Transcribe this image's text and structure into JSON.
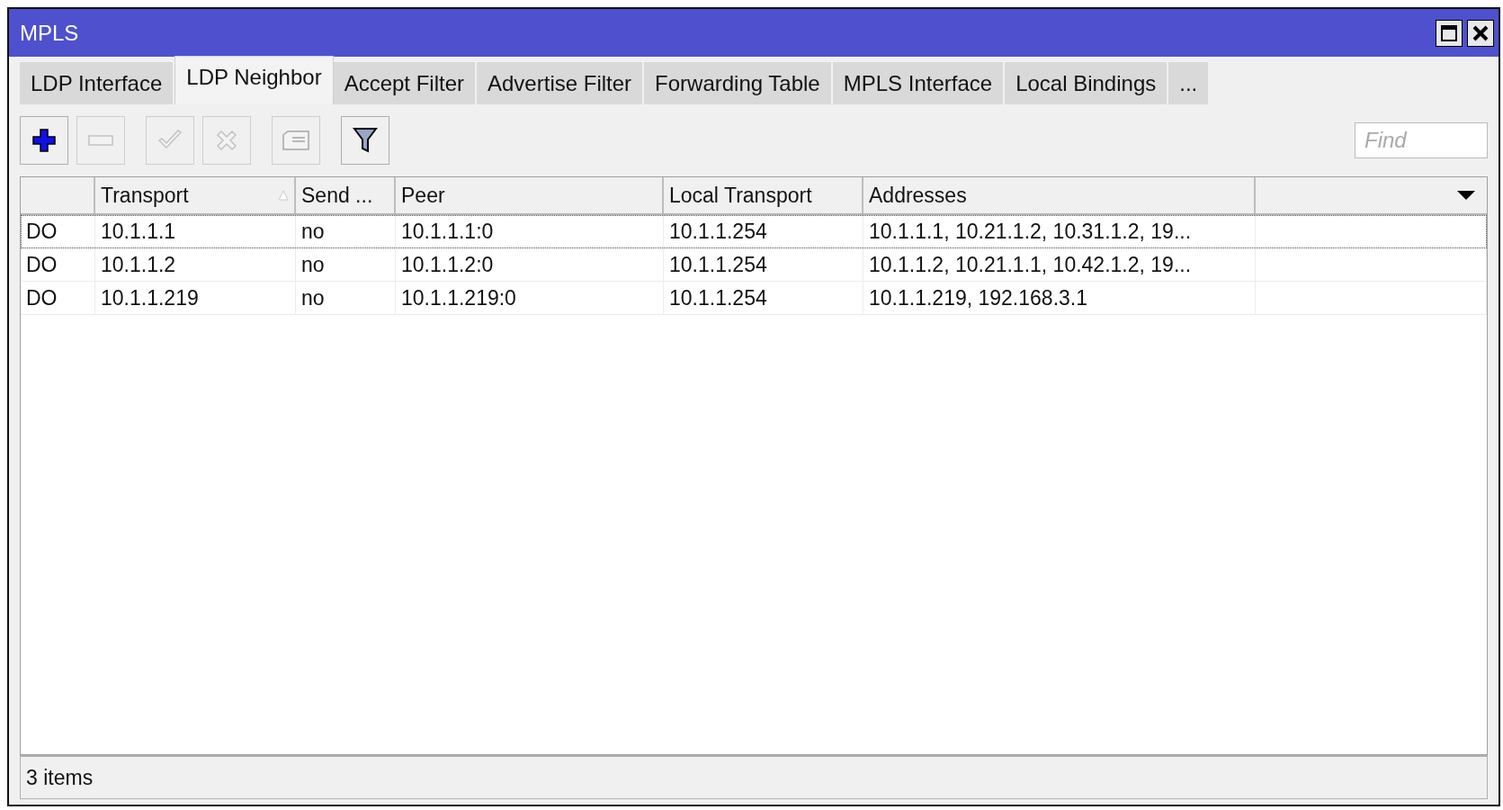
{
  "window": {
    "title": "MPLS"
  },
  "tabs": [
    {
      "label": "LDP Interface",
      "selected": false
    },
    {
      "label": "LDP Neighbor",
      "selected": true
    },
    {
      "label": "Accept Filter",
      "selected": false
    },
    {
      "label": "Advertise Filter",
      "selected": false
    },
    {
      "label": "Forwarding Table",
      "selected": false
    },
    {
      "label": "MPLS Interface",
      "selected": false
    },
    {
      "label": "Local Bindings",
      "selected": false
    },
    {
      "label": "...",
      "selected": false
    }
  ],
  "toolbar": [
    {
      "kind": "add",
      "disabled": false
    },
    {
      "kind": "remove",
      "disabled": true
    },
    {
      "kind": "enable",
      "disabled": true
    },
    {
      "kind": "disable",
      "disabled": true
    },
    {
      "kind": "comment",
      "disabled": true
    },
    {
      "kind": "filter",
      "disabled": false
    }
  ],
  "search": {
    "placeholder": "Find"
  },
  "table": {
    "columns": [
      {
        "sorted": false
      },
      {
        "label": "Transport",
        "sorted": true
      },
      {
        "label": "Send ...",
        "sorted": false
      },
      {
        "label": "Peer",
        "sorted": false
      },
      {
        "label": "Local Transport",
        "sorted": false
      },
      {
        "label": "Addresses",
        "sorted": false
      }
    ],
    "rows": [
      {
        "selected": true,
        "cells": [
          "DO",
          "10.1.1.1",
          "no",
          "10.1.1.1:0",
          "10.1.1.254",
          "10.1.1.1, 10.21.1.2, 10.31.1.2, 19..."
        ]
      },
      {
        "selected": false,
        "cells": [
          "DO",
          "10.1.1.2",
          "no",
          "10.1.1.2:0",
          "10.1.1.254",
          "10.1.1.2, 10.21.1.1, 10.42.1.2, 19..."
        ]
      },
      {
        "selected": false,
        "cells": [
          "DO",
          "10.1.1.219",
          "no",
          "10.1.1.219:0",
          "10.1.1.254",
          "10.1.1.219, 192.168.3.1"
        ]
      }
    ]
  },
  "status_bar": {
    "text": "3 items"
  }
}
